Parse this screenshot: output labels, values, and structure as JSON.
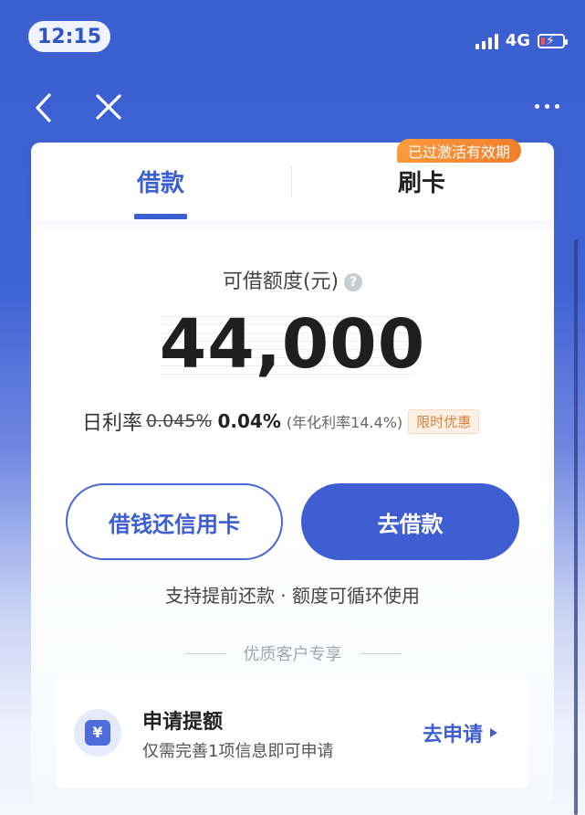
{
  "status": {
    "time": "12:15",
    "network": "4G"
  },
  "tabs": [
    {
      "label": "借款",
      "active": true
    },
    {
      "label": "刷卡",
      "active": false
    }
  ],
  "promo_badge": "已过激活有效期",
  "limit": {
    "label": "可借额度(元)",
    "help_glyph": "?",
    "amount": "44,000"
  },
  "rate": {
    "label": "日利率",
    "old": "0.045%",
    "new": "0.04%",
    "annual": "(年化利率14.4%)",
    "badge": "限时优惠"
  },
  "buttons": {
    "repay_card": "借钱还信用卡",
    "borrow": "去借款"
  },
  "feature_note": "支持提前还款 · 额度可循环使用",
  "section_header": "优质客户专享",
  "apply": {
    "icon_glyph": "¥",
    "title": "申请提额",
    "subtitle": "仅需完善1项信息即可申请",
    "action": "去申请"
  },
  "icons": {
    "back": "chevron-left-icon",
    "close": "close-icon",
    "more": "more-icon",
    "signal": "signal-icon",
    "battery": "battery-charging-icon",
    "help": "question-icon",
    "yuan": "yuan-icon",
    "arrow": "triangle-right-icon"
  },
  "colors": {
    "brand": "#3e5fcf",
    "promo": "#f07f2c",
    "battery_low": "#ff4a4a"
  }
}
